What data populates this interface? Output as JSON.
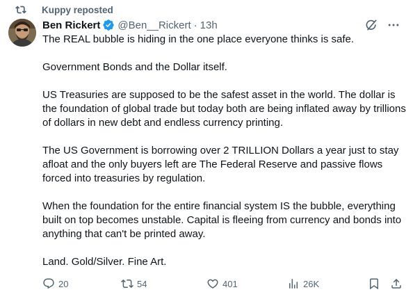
{
  "repost": {
    "label": "Kuppy reposted"
  },
  "tweet": {
    "author_name": "Ben Rickert",
    "handle": "@Ben__Rickert",
    "separator": "·",
    "time": "13h",
    "paragraphs": [
      "The REAL bubble is hiding in the one place everyone thinks is safe.",
      "Government Bonds and the Dollar itself.",
      "US Treasuries are supposed to be the safest asset in the world. The dollar is the foundation of global trade but today both are being inflated away by trillions of dollars in new debt and endless currency printing.",
      "The US Government is borrowing over 2 TRILLION Dollars a year just to stay afloat and the only buyers left are The Federal Reserve and passive flows forced into treasuries by regulation.",
      "When the foundation for the entire financial system IS the bubble, everything built on top becomes unstable. Capital is fleeing from currency and bonds into anything that can't be printed away.",
      "Land. Gold/Silver. Fine Art."
    ]
  },
  "actions": {
    "replies": "20",
    "reposts": "54",
    "likes": "401",
    "views": "26K"
  },
  "icons": {
    "repost_header": "repost-icon",
    "verified": "verified-badge-icon",
    "grok": "grok-icon",
    "more": "more-icon",
    "reply": "reply-icon",
    "retweet": "repost-icon",
    "like": "heart-icon",
    "views": "views-icon",
    "bookmark": "bookmark-icon",
    "share": "share-icon"
  },
  "colors": {
    "text": "#0f1419",
    "secondary": "#536471",
    "verified": "#1d9bf0"
  }
}
